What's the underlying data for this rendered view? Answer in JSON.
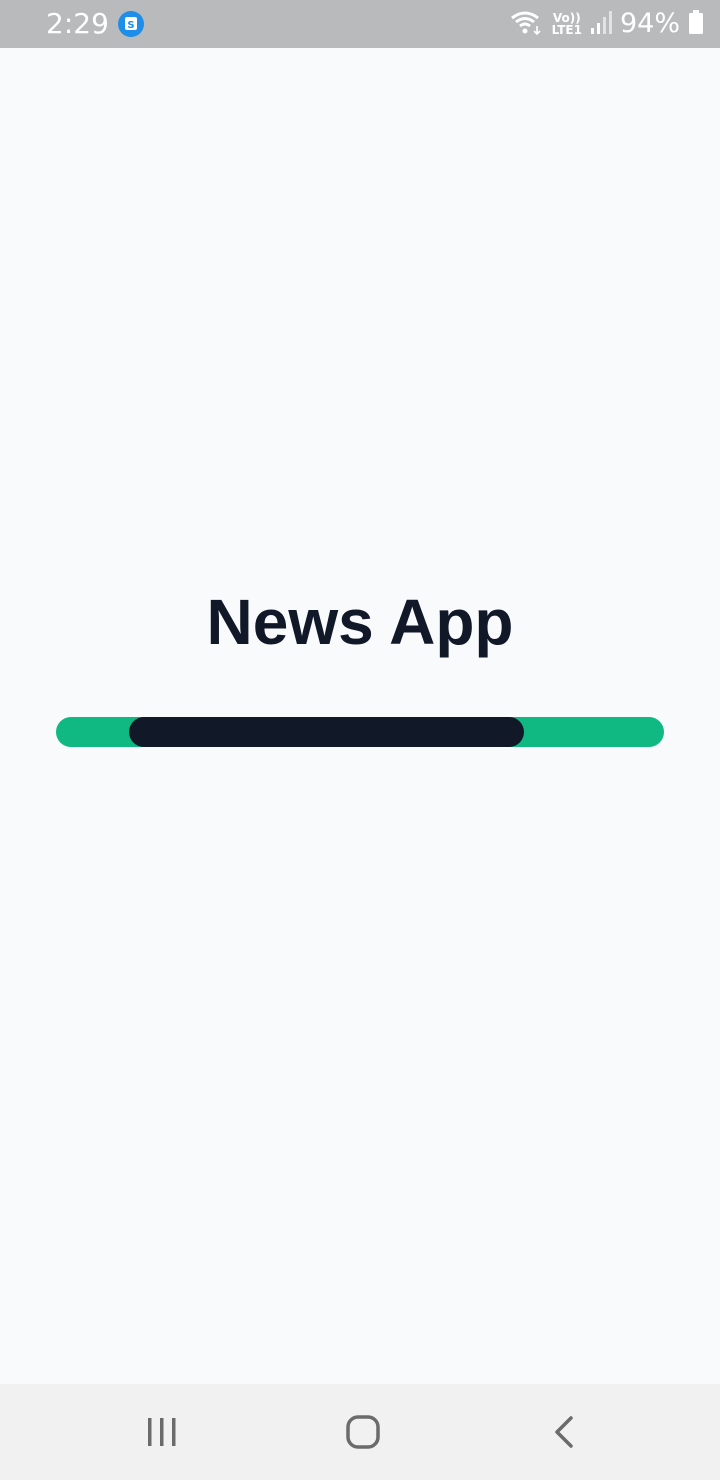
{
  "status_bar": {
    "time": "2:29",
    "notification_icon": "s-app-icon",
    "wifi_icon": "wifi-icon",
    "network_label_top": "Vo))",
    "network_label_bottom": "LTE1",
    "signal_icon": "signal-icon",
    "battery_percent": "94%",
    "battery_icon": "battery-icon"
  },
  "main": {
    "title": "News App",
    "loading_progress": {
      "indicator_start_fraction": 0.12,
      "indicator_end_fraction": 0.77
    }
  },
  "colors": {
    "background": "#f8fafc",
    "title": "#111827",
    "track": "#10b981",
    "indicator": "#111827",
    "status_bar": "#b9babc",
    "nav_bar": "#f1f1f1"
  },
  "nav_bar": {
    "recents_icon": "recents-icon",
    "home_icon": "home-icon",
    "back_icon": "back-icon"
  }
}
